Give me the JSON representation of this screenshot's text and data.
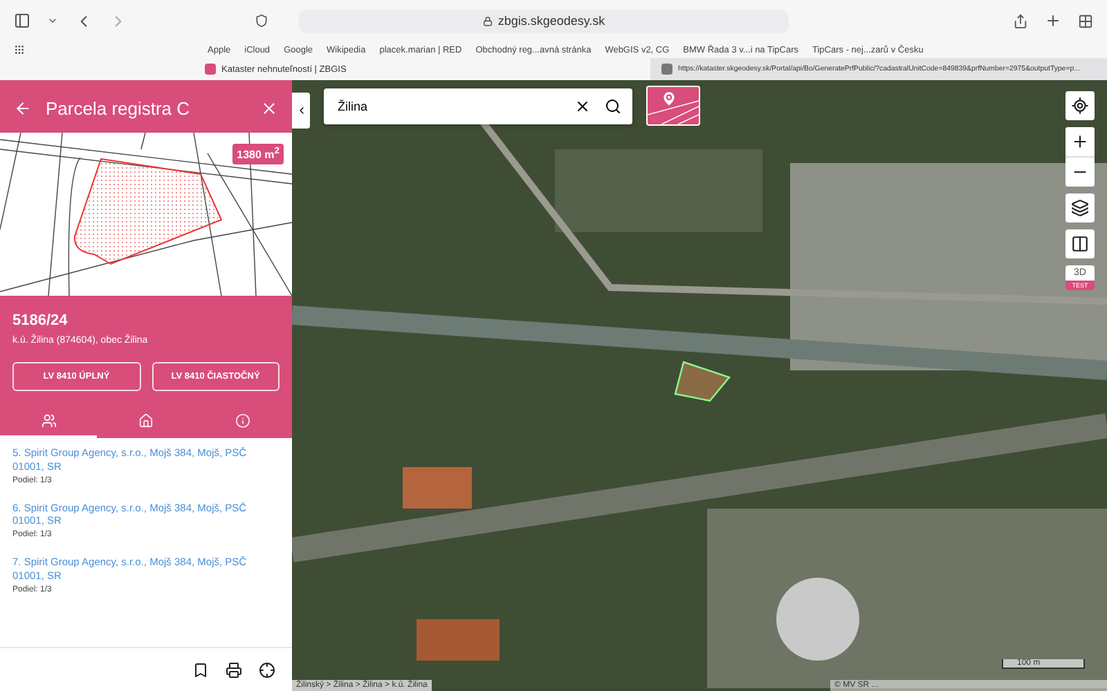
{
  "browser": {
    "address": "zbgis.skgeodesy.sk",
    "bookmarks": [
      "Apple",
      "iCloud",
      "Google",
      "Wikipedia",
      "placek.marian | RED",
      "Obchodný reg...avná stránka",
      "WebGIS v2, CG",
      "BMW Řada 3 v...i na TipCars",
      "TipCars - nej...zarů v Česku"
    ],
    "tabs": [
      {
        "title": "Kataster nehnuteľností | ZBGIS",
        "selected": true
      },
      {
        "title": "https://kataster.skgeodesy.sk/Portal/api/Bo/GeneratePrfPublic/?cadastralUnitCode=849839&prfNumber=2975&outputType=p...",
        "selected": false
      }
    ]
  },
  "panel": {
    "title": "Parcela registra C",
    "area": "1380 m$^{2}$",
    "parcel_number": "5186/24",
    "location": "k.ú. Žilina (874604), obec Žilina",
    "buttons": [
      "LV 8410 ÚPLNÝ",
      "LV 8410 ČIASTOČNÝ"
    ],
    "tabs": [
      {
        "kind": "owners",
        "selected": true
      },
      {
        "kind": "building",
        "selected": false
      },
      {
        "kind": "info",
        "selected": false
      }
    ],
    "owners": [
      {
        "name": "5. Spirit Group Agency, s.r.o., Mojš 384, Mojš, PSČ 01001, SR",
        "share": "Podiel: 1/3"
      },
      {
        "name": "6. Spirit Group Agency, s.r.o., Mojš 384, Mojš, PSČ 01001, SR",
        "share": "Podiel: 1/3"
      },
      {
        "name": "7. Spirit Group Agency, s.r.o., Mojš 384, Mojš, PSČ 01001, SR",
        "share": "Podiel: 1/3"
      }
    ]
  },
  "map": {
    "search": {
      "value": "Žilina"
    },
    "mode_3d": "3D",
    "test_badge": "TEST",
    "breadcrumb": "Žilinský > Žilina > Žilina > k.ú. Žilina",
    "scale": "100 m",
    "attribution": "© MV SR ..."
  }
}
